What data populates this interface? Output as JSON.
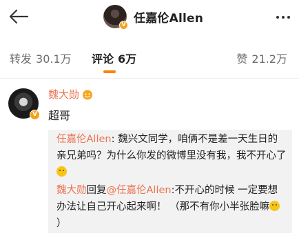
{
  "header": {
    "title": "任嘉伦Allen",
    "back_icon": "back-arrow-icon",
    "more_icon": "more-dots-icon"
  },
  "tabs": [
    {
      "label": "转发",
      "count": "30.1万"
    },
    {
      "label": "评论",
      "count": "6万",
      "active": true
    },
    {
      "label": "赞",
      "count": "21.2万"
    }
  ],
  "colors": {
    "accent": "#ff8200",
    "username": "#eb7350",
    "verified": "#f7a21b"
  },
  "comment": {
    "user": "魏大勋",
    "text": "超哥",
    "replies": [
      {
        "user": "任嘉伦Allen",
        "sep": ": ",
        "text": "魏兴文同学，咱俩不是差一天生日的亲兄弟吗？为什么你发的微博里没有我，我不开心了"
      },
      {
        "user": "魏大勋",
        "mid": "回复",
        "target": "@任嘉伦Allen",
        "sep": ":",
        "text": "不开心的时候 一定要想办法让自己开心起来啊！ （那不有你小半张脸嘛",
        "tail": "）"
      }
    ]
  }
}
